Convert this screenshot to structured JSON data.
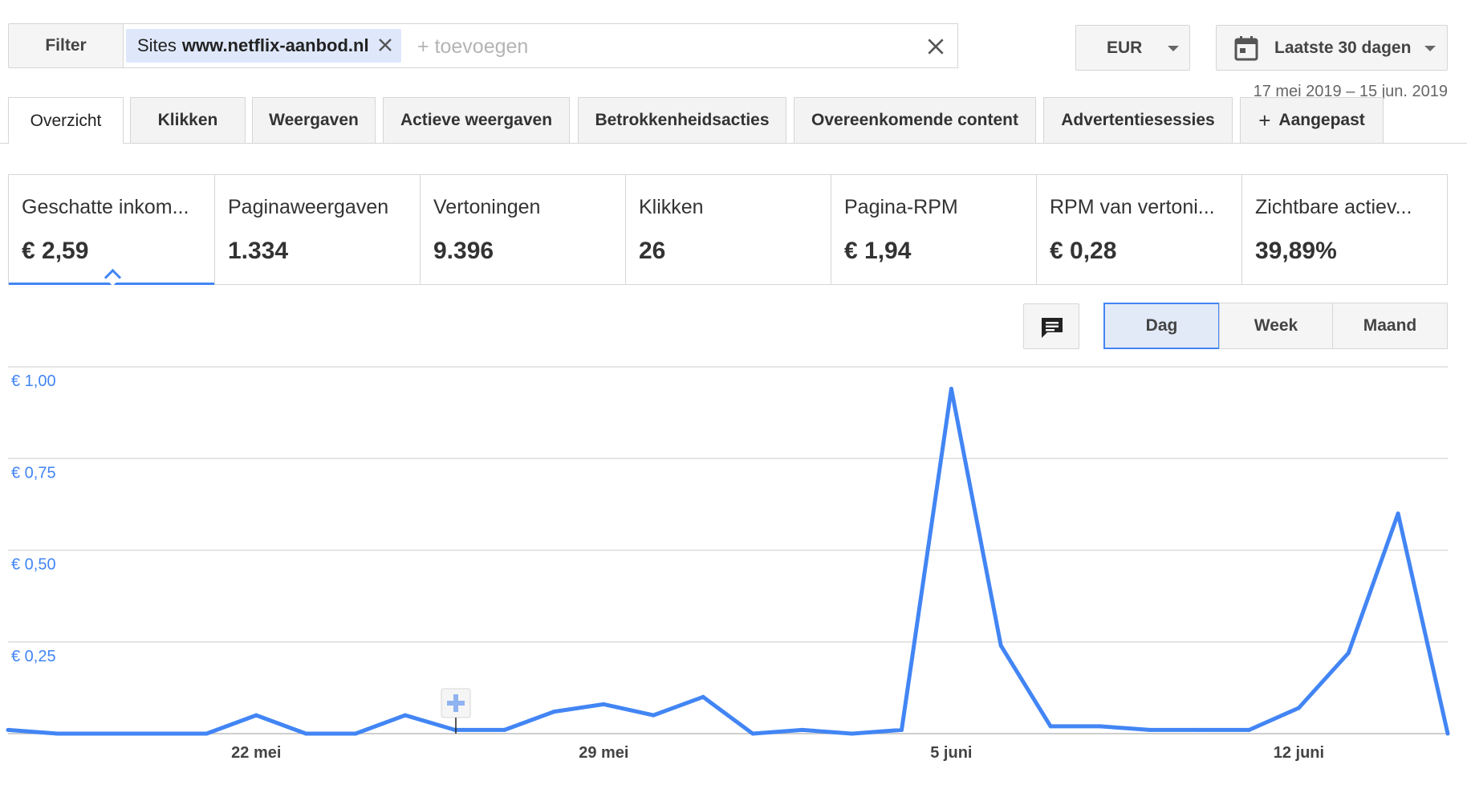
{
  "filter": {
    "button_label": "Filter",
    "chip_prefix": "Sites",
    "chip_site": "www.netflix-aanbod.nl",
    "add_placeholder": "+ toevoegen"
  },
  "currency": {
    "label": "EUR"
  },
  "date": {
    "label": "Laatste 30 dagen",
    "range": "17 mei 2019 – 15 jun. 2019"
  },
  "tabs": [
    {
      "label": "Overzicht"
    },
    {
      "label": "Klikken"
    },
    {
      "label": "Weergaven"
    },
    {
      "label": "Actieve weergaven"
    },
    {
      "label": "Betrokkenheidsacties"
    },
    {
      "label": "Overeenkomende content"
    },
    {
      "label": "Advertentiesessies"
    },
    {
      "label": "Aangepast"
    }
  ],
  "metrics": [
    {
      "name": "Geschatte inkom...",
      "value": "€ 2,59"
    },
    {
      "name": "Paginaweergaven",
      "value": "1.334"
    },
    {
      "name": "Vertoningen",
      "value": "9.396"
    },
    {
      "name": "Klikken",
      "value": "26"
    },
    {
      "name": "Pagina-RPM",
      "value": "€ 1,94"
    },
    {
      "name": "RPM van vertoni...",
      "value": "€ 0,28"
    },
    {
      "name": "Zichtbare actiev...",
      "value": "39,89%"
    }
  ],
  "granularity": {
    "day": "Dag",
    "week": "Week",
    "month": "Maand"
  },
  "icons": {
    "calendar": "calendar-icon",
    "comment": "comment-icon",
    "close": "close-icon",
    "dropdown": "chevron-down-icon",
    "annotation": "add-annotation-icon"
  },
  "colors": {
    "accent": "#4285f4",
    "line": "#4285f4"
  },
  "chart_data": {
    "type": "line",
    "x": [
      "2019-05-17",
      "2019-05-18",
      "2019-05-19",
      "2019-05-20",
      "2019-05-21",
      "2019-05-22",
      "2019-05-23",
      "2019-05-24",
      "2019-05-25",
      "2019-05-26",
      "2019-05-27",
      "2019-05-28",
      "2019-05-29",
      "2019-05-30",
      "2019-05-31",
      "2019-06-01",
      "2019-06-02",
      "2019-06-03",
      "2019-06-04",
      "2019-06-05",
      "2019-06-06",
      "2019-06-07",
      "2019-06-08",
      "2019-06-09",
      "2019-06-10",
      "2019-06-11",
      "2019-06-12",
      "2019-06-13",
      "2019-06-14",
      "2019-06-15"
    ],
    "series": [
      {
        "values": [
          0.01,
          0,
          0,
          0,
          0,
          0.05,
          0,
          0,
          0.05,
          0.01,
          0.01,
          0.06,
          0.08,
          0.05,
          0.1,
          0,
          0.01,
          0,
          0.01,
          0.94,
          0.24,
          0.02,
          0.02,
          0.01,
          0.01,
          0.01,
          0.07,
          0.22,
          0.6,
          0
        ]
      }
    ],
    "y_ticks": [
      "€ 0,25",
      "€ 0,50",
      "€ 0,75",
      "€ 1,00"
    ],
    "y_tick_values": [
      0.25,
      0.5,
      0.75,
      1.0
    ],
    "ylim": [
      0,
      1.0
    ],
    "x_ticks": [
      {
        "label": "22 mei",
        "x": "2019-05-22"
      },
      {
        "label": "29 mei",
        "x": "2019-05-29"
      },
      {
        "label": "5 juni",
        "x": "2019-06-05"
      },
      {
        "label": "12 juni",
        "x": "2019-06-12"
      }
    ],
    "grid": true
  }
}
